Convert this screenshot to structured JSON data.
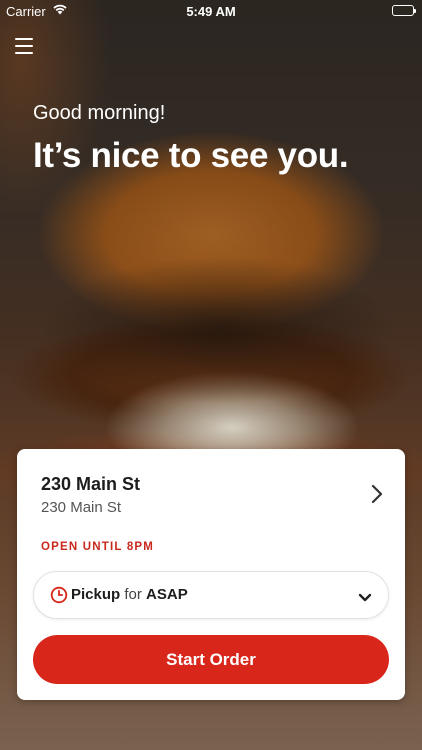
{
  "status_bar": {
    "carrier": "Carrier",
    "time": "5:49 AM"
  },
  "header": {
    "greeting": "Good morning!",
    "headline": "It’s nice to see you."
  },
  "store": {
    "name": "230 Main St",
    "address": "230 Main St",
    "status": "OPEN UNTIL 8PM"
  },
  "order_mode": {
    "mode": "Pickup",
    "connector": "for",
    "time": "ASAP"
  },
  "actions": {
    "start_order": "Start Order"
  },
  "colors": {
    "accent": "#d9261b",
    "status_text": "#c8281c"
  }
}
